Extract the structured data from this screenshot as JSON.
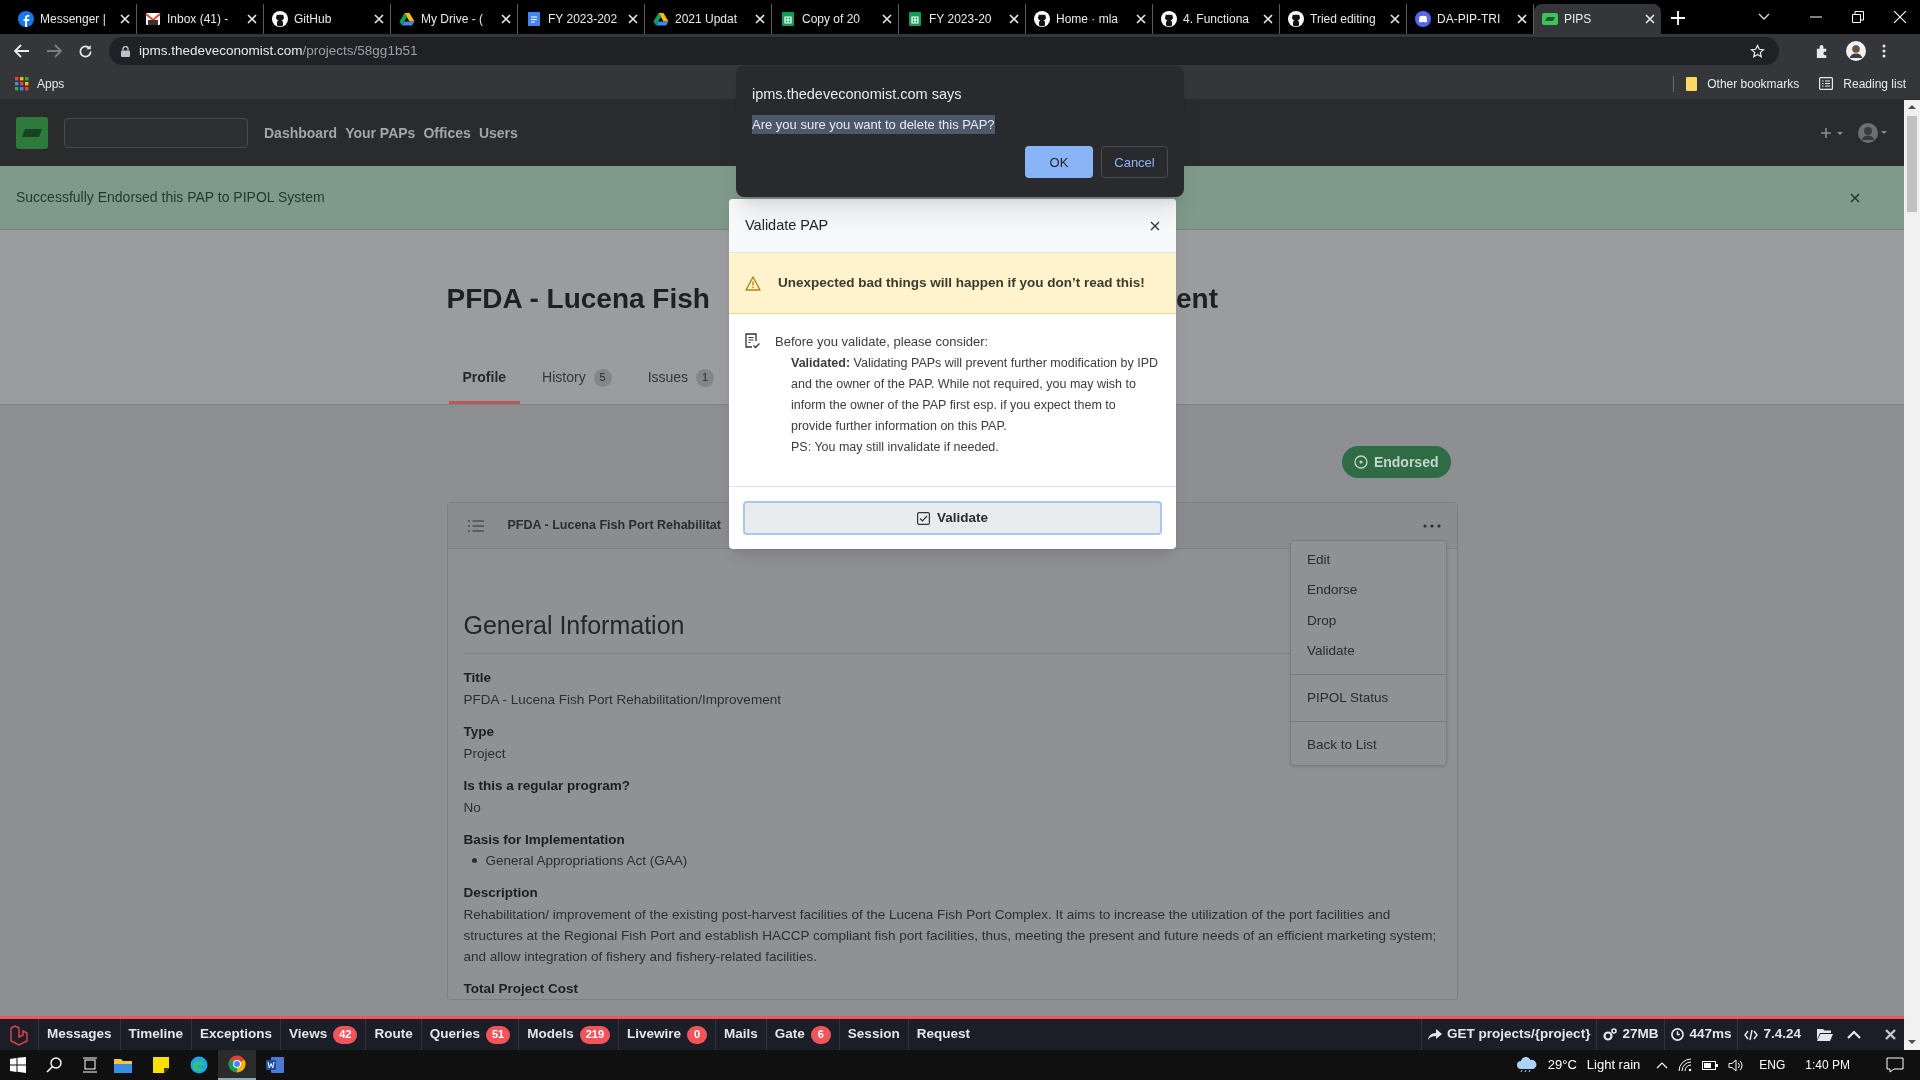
{
  "browser": {
    "tabs": [
      {
        "title": "Messenger |",
        "kind": "facebook",
        "selected": false
      },
      {
        "title": "Inbox (41) -",
        "kind": "gmail",
        "selected": false
      },
      {
        "title": "GitHub",
        "kind": "github",
        "selected": false
      },
      {
        "title": "My Drive - (",
        "kind": "drive",
        "selected": false
      },
      {
        "title": "FY 2023-202",
        "kind": "docs",
        "selected": false
      },
      {
        "title": "2021 Updat",
        "kind": "drive",
        "selected": false
      },
      {
        "title": "Copy of 20",
        "kind": "sheets",
        "selected": false
      },
      {
        "title": "FY 2023-20",
        "kind": "sheets",
        "selected": false
      },
      {
        "title": "Home · mla",
        "kind": "github",
        "selected": false
      },
      {
        "title": "4. Functiona",
        "kind": "github",
        "selected": false
      },
      {
        "title": "Tried editing",
        "kind": "github",
        "selected": false
      },
      {
        "title": "DA-PIP-TRI",
        "kind": "discord",
        "selected": false
      },
      {
        "title": "PIPS",
        "kind": "pips",
        "selected": true
      }
    ],
    "url_host": "ipms.thedeveconomist.com",
    "url_path": "/projects/58gg1b51",
    "bookmarks": [
      "Apps"
    ],
    "other_bookmarks": "Other bookmarks",
    "reading_list": "Reading list"
  },
  "alert_dialog": {
    "title": "ipms.thedeveconomist.com says",
    "message": "Are you sure you want to delete this PAP?",
    "ok": "OK",
    "cancel": "Cancel"
  },
  "app": {
    "nav": [
      "Dashboard",
      "Your PAPs",
      "Offices",
      "Users"
    ]
  },
  "flash": {
    "message": "Successfully Endorsed this PAP to PIPOL System"
  },
  "page": {
    "title_parts": [
      "PFDA - Lucena Fish",
      "ent"
    ],
    "tabs": [
      {
        "label": "Profile",
        "selected": true
      },
      {
        "label": "History",
        "count": "5",
        "selected": false
      },
      {
        "label": "Issues",
        "count": "1",
        "selected": false
      }
    ],
    "status": "Endorsed",
    "card": {
      "title": "PFDA - Lucena Fish Port Rehabilitat",
      "section": "General Information",
      "fields": [
        {
          "label": "Title",
          "value": "PFDA - Lucena Fish Port Rehabilitation/Improvement"
        },
        {
          "label": "Type",
          "value": "Project"
        },
        {
          "label": "Is this a regular program?",
          "value": "No"
        },
        {
          "label": "Basis for Implementation",
          "items": [
            "General Appropriations Act (GAA)"
          ]
        },
        {
          "label": "Description",
          "value": "Rehabilitation/ improvement of the existing post-harvest facilities of the Lucena Fish Port Complex. It aims to increase the utilization of the port facilities and structures at the Regional Fish Port and establish HACCP compliant fish port facilities, thus, meeting the present and future needs of an efficient marketing system; and allow integration of fishery and fishery-related facilities."
        },
        {
          "label": "Total Project Cost"
        }
      ]
    },
    "menu": [
      [
        "Edit",
        "Endorse",
        "Drop",
        "Validate"
      ],
      [
        "PIPOL Status"
      ],
      [
        "Back to List"
      ]
    ]
  },
  "modal": {
    "title": "Validate PAP",
    "warning": "Unexpected bad things will happen if you don’t read this!",
    "intro": "Before you validate, please consider:",
    "note": "**Validated:** Validating PAPs will prevent further modification by IPD and the owner of the PAP. While not required, you may wish to inform the owner of the PAP first esp. if you expect them to provide further information on this PAP.",
    "ps": "PS: You may still invalidate if needed.",
    "button": "Validate"
  },
  "debug_bar": {
    "items": [
      {
        "label": "Messages"
      },
      {
        "label": "Timeline"
      },
      {
        "label": "Exceptions"
      },
      {
        "label": "Views",
        "count": "42"
      },
      {
        "label": "Route"
      },
      {
        "label": "Queries",
        "count": "51"
      },
      {
        "label": "Models",
        "count": "219"
      },
      {
        "label": "Livewire",
        "count": "0"
      },
      {
        "label": "Mails"
      },
      {
        "label": "Gate",
        "count": "6"
      },
      {
        "label": "Session"
      },
      {
        "label": "Request"
      }
    ],
    "route": "GET projects/{project}",
    "memory": "27MB",
    "time": "447ms",
    "version": "7.4.24"
  },
  "taskbar": {
    "apps": [
      {
        "kind": "explorer",
        "selected": false
      },
      {
        "kind": "notes",
        "selected": false
      },
      {
        "kind": "edge",
        "selected": false
      },
      {
        "kind": "chrome",
        "selected": true
      },
      {
        "kind": "word",
        "selected": false
      }
    ],
    "temperature": "29°C",
    "weather": "Light rain",
    "language": "ENG",
    "clock": "1:40 PM"
  }
}
